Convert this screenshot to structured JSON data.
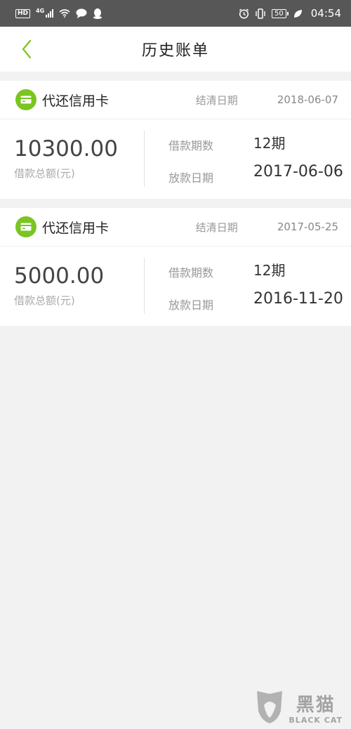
{
  "status_bar": {
    "hd": "HD",
    "network": "4G",
    "battery": "50",
    "time": "04:54"
  },
  "header": {
    "title": "历史账单"
  },
  "colors": {
    "accent": "#7ac520",
    "status_bar_bg": "#575757"
  },
  "bills": [
    {
      "type": "代还信用卡",
      "settle_label": "结清日期",
      "settle_date": "2018-06-07",
      "amount": "10300.00",
      "amount_label": "借款总额(元)",
      "periods_label": "借款期数",
      "periods": "12期",
      "loan_date_label": "放款日期",
      "loan_date": "2017-06-06"
    },
    {
      "type": "代还信用卡",
      "settle_label": "结清日期",
      "settle_date": "2017-05-25",
      "amount": "5000.00",
      "amount_label": "借款总额(元)",
      "periods_label": "借款期数",
      "periods": "12期",
      "loan_date_label": "放款日期",
      "loan_date": "2016-11-20"
    }
  ],
  "watermark": {
    "cn": "黑猫",
    "en": "BLACK CAT"
  },
  "icons": {
    "back": "chevron-left-icon",
    "card": "credit-card-icon"
  }
}
